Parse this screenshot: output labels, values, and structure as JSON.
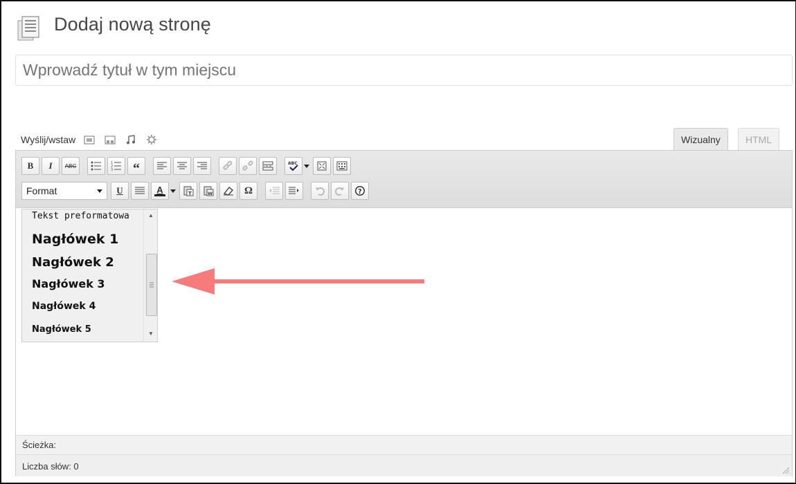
{
  "page": {
    "title": "Dodaj nową stronę",
    "title_placeholder": "Wprowadź tytuł w tym miejscu"
  },
  "upload": {
    "label": "Wyślij/wstaw",
    "icons": [
      "image-icon",
      "gallery-icon",
      "audio-icon",
      "media-icon"
    ]
  },
  "tabs": {
    "visual": "Wizualny",
    "html": "HTML"
  },
  "toolbar": {
    "bold": "B",
    "italic": "I",
    "strikethrough": "ABC",
    "blockquote": "“",
    "format_label": "Format",
    "underline": "U",
    "text_color": "A",
    "omega": "Ω"
  },
  "format_menu": {
    "items": [
      "Tekst preformatowa",
      "Nagłówek 1",
      "Nagłówek 2",
      "Nagłówek 3",
      "Nagłówek 4",
      "Nagłówek 5"
    ]
  },
  "status": {
    "path_label": "Ścieżka:",
    "word_count": "Liczba słów: 0"
  },
  "colors": {
    "arrow": "#f77b7b",
    "toolbar_bg": "#e3e3e3"
  }
}
